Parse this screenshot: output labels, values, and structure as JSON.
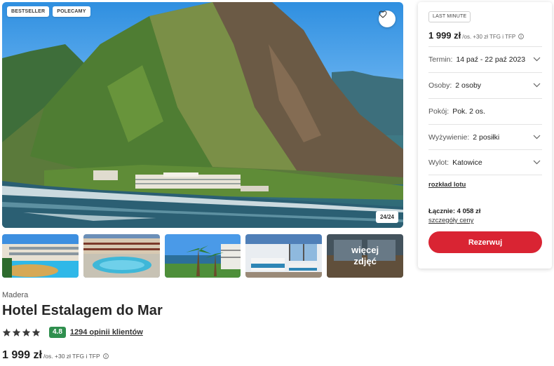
{
  "gallery": {
    "badges": [
      "BESTSELLER",
      "POLECAMY"
    ],
    "counter": "24/24",
    "more_label": "więcej zdjęć",
    "icons": {
      "favorite": "heart-outline-icon"
    }
  },
  "hotel": {
    "region": "Madera",
    "name": "Hotel Estalagem do Mar",
    "stars": 4,
    "score": "4.8",
    "reviews": "1294 opinii klientów",
    "price": "1 999 zł",
    "price_note": "/os. +30 zł TFG i TFP"
  },
  "booking": {
    "badge": "LAST MINUTE",
    "price": "1 999 zł",
    "price_note": "/os. +30 zł TFG i TFP",
    "rows": [
      {
        "label": "Termin:",
        "value": "14 paź - 22 paź 2023",
        "dropdown": true
      },
      {
        "label": "Osoby:",
        "value": "2 osoby",
        "dropdown": true
      },
      {
        "label": "Pokój:",
        "value": "Pok. 2 os.",
        "dropdown": false
      },
      {
        "label": "Wyżywienie:",
        "value": "2 posiłki",
        "dropdown": true
      },
      {
        "label": "Wylot:",
        "value": "Katowice",
        "dropdown": true
      }
    ],
    "flight_link": "rozkład lotu",
    "total": "Łącznie: 4 058 zł",
    "details_link": "szczegóły ceny",
    "reserve_label": "Rezerwuj"
  },
  "colors": {
    "accent_red": "#d92433",
    "score_green": "#2f8f4e"
  }
}
